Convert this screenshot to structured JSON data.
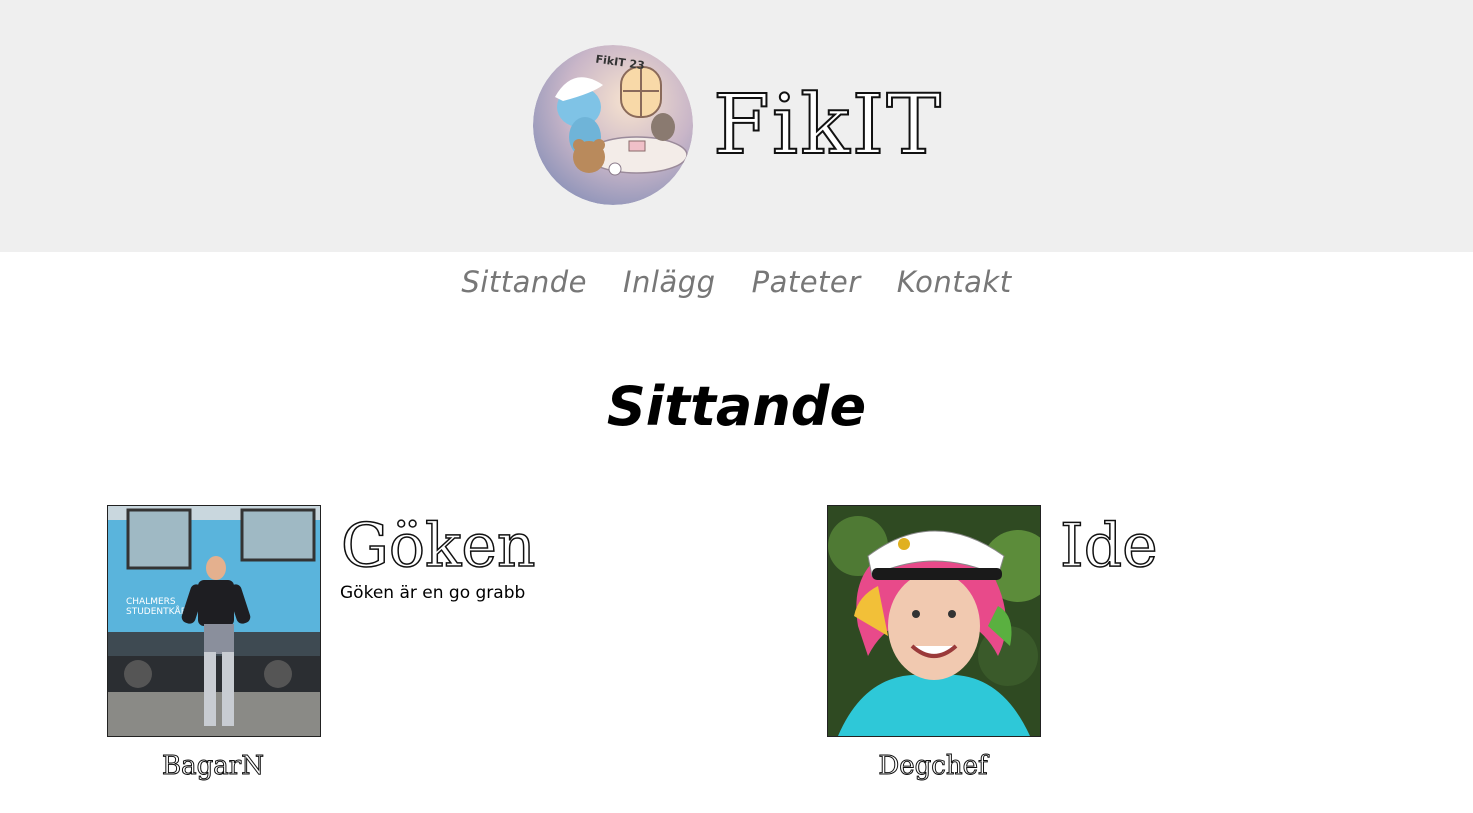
{
  "header": {
    "logo_text": "FikIT 23",
    "site_title": "FikIT"
  },
  "nav": {
    "items": [
      "Sittande",
      "Inlägg",
      "Pateter",
      "Kontakt"
    ]
  },
  "page": {
    "title": "Sittande"
  },
  "members": [
    {
      "name": "Göken",
      "description": "Göken är en go grabb",
      "role": "BagarN",
      "photo_badge": "CHALMERS STUDENTKÅR"
    },
    {
      "name": "Ide",
      "description": "",
      "role": "Degchef"
    }
  ],
  "colors": {
    "header_bg": "#efefef",
    "nav_link": "#777777",
    "title": "#000000"
  }
}
